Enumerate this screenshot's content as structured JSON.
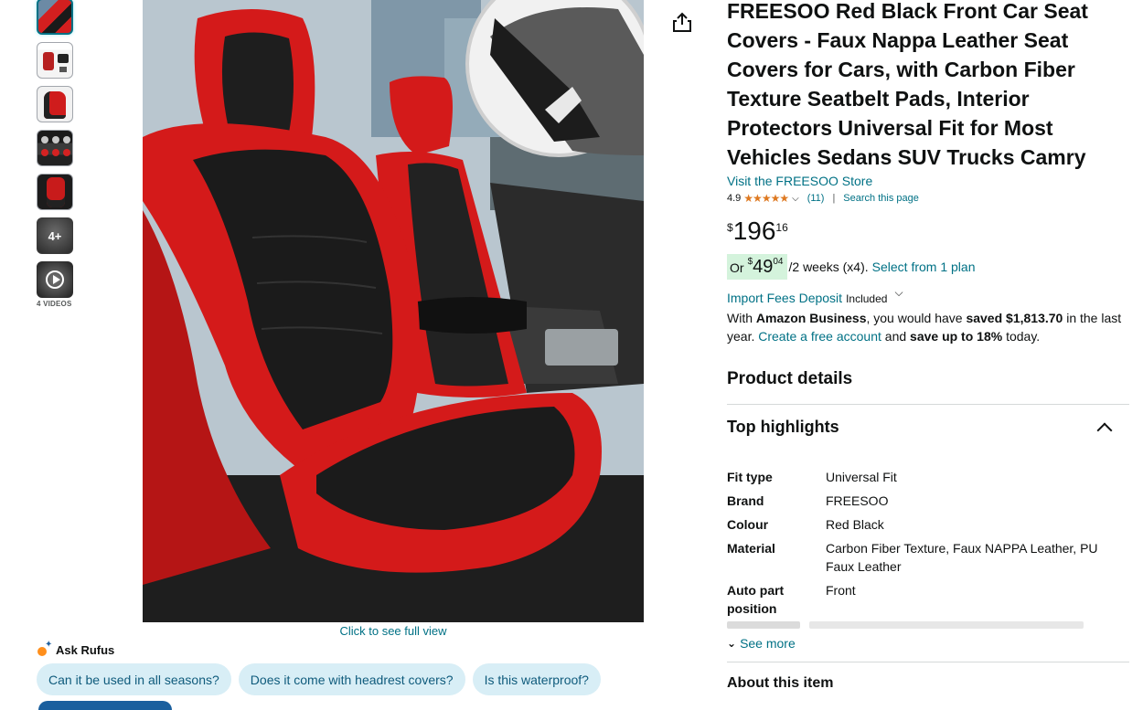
{
  "gallery": {
    "thumbnails": [
      "thumb-1",
      "thumb-2",
      "thumb-3",
      "thumb-4",
      "thumb-5"
    ],
    "more_label": "4+",
    "videos_label": "4 VIDEOS",
    "full_view_label": "Click to see full view"
  },
  "rufus": {
    "label": "Ask Rufus",
    "questions": [
      "Can it be used in all seasons?",
      "Does it come with headrest covers?",
      "Is this waterproof?"
    ]
  },
  "product": {
    "title": "FREESOO Red Black Front Car Seat Covers - Faux Nappa Leather Seat Covers for Cars, with Carbon Fiber Texture Seatbelt Pads, Interior Protectors Universal Fit for Most Vehicles Sedans SUV Trucks Camry",
    "store_link": "Visit the FREESOO Store",
    "rating": "4.9",
    "stars": "★★★★★",
    "rating_count": "(11)",
    "search_page": "Search this page"
  },
  "price": {
    "symbol": "$",
    "whole": "196",
    "fraction": "16"
  },
  "installment": {
    "or": "Or",
    "symbol": "$",
    "whole": "49",
    "fraction": "04",
    "rest": "/2 weeks (x4).",
    "plan_link": "Select from 1 plan"
  },
  "import": {
    "link": "Import Fees Deposit",
    "included": "Included"
  },
  "business": {
    "p1": "With ",
    "brand": "Amazon Business",
    "p2": ", you would have ",
    "saved": "saved $1,813.70",
    "p3": " in the last year. ",
    "link": "Create a free account",
    "p4": " and ",
    "save_up": "save up to 18%",
    "p5": " today."
  },
  "sections": {
    "product_details": "Product details",
    "top_highlights": "Top highlights",
    "see_more": "See more",
    "about": "About this item"
  },
  "details": [
    {
      "key": "Fit type",
      "value": "Universal Fit"
    },
    {
      "key": "Brand",
      "value": "FREESOO"
    },
    {
      "key": "Colour",
      "value": "Red Black"
    },
    {
      "key": "Material",
      "value": "Carbon Fiber Texture, Faux NAPPA Leather, PU Faux Leather"
    },
    {
      "key": "Auto part position",
      "value": "Front"
    }
  ]
}
